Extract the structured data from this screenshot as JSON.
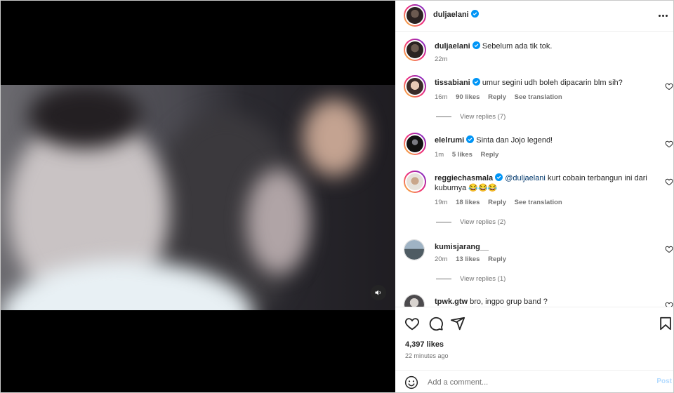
{
  "post": {
    "author": "duljaelani",
    "caption": "Sebelum ada tik tok.",
    "caption_time": "22m",
    "likes": "4,397 likes",
    "time_ago": "22 minutes ago"
  },
  "comments": [
    {
      "user": "tissabiani",
      "verified": true,
      "text": "umur segini udh boleh dipacarin blm sih?",
      "time": "16m",
      "likes": "90 likes",
      "reply": "Reply",
      "translate": "See translation",
      "view_replies": "View replies (7)"
    },
    {
      "user": "elelrumi",
      "verified": true,
      "text": "Sinta dan Jojo legend!",
      "time": "1m",
      "likes": "5 likes",
      "reply": "Reply",
      "translate": "",
      "view_replies": ""
    },
    {
      "user": "reggiechasmala",
      "verified": true,
      "mention": "@duljaelani",
      "text": "kurt cobain terbangun ini dari kuburnya 😂😂😂",
      "time": "19m",
      "likes": "18 likes",
      "reply": "Reply",
      "translate": "See translation",
      "view_replies": "View replies (2)"
    },
    {
      "user": "kumisjarang__",
      "verified": false,
      "text": "",
      "time": "20m",
      "likes": "13 likes",
      "reply": "Reply",
      "translate": "",
      "view_replies": "View replies (1)"
    },
    {
      "user": "tpwk.gtw",
      "verified": false,
      "text": "bro, ingpo grup band ?",
      "time": "",
      "likes": "",
      "reply": "",
      "translate": "",
      "view_replies": ""
    }
  ],
  "composer": {
    "placeholder": "Add a comment...",
    "post_label": "Post"
  },
  "icons": {
    "verified": "verified-badge-icon",
    "like": "heart-icon",
    "comment": "comment-icon",
    "share": "share-icon",
    "save": "bookmark-icon",
    "emoji": "emoji-icon",
    "more": "more-options-icon",
    "audio": "speaker-icon"
  },
  "colors": {
    "verified": "#0095f6",
    "link": "#00376b",
    "muted": "#737373",
    "post_disabled": "#b3dbff"
  }
}
